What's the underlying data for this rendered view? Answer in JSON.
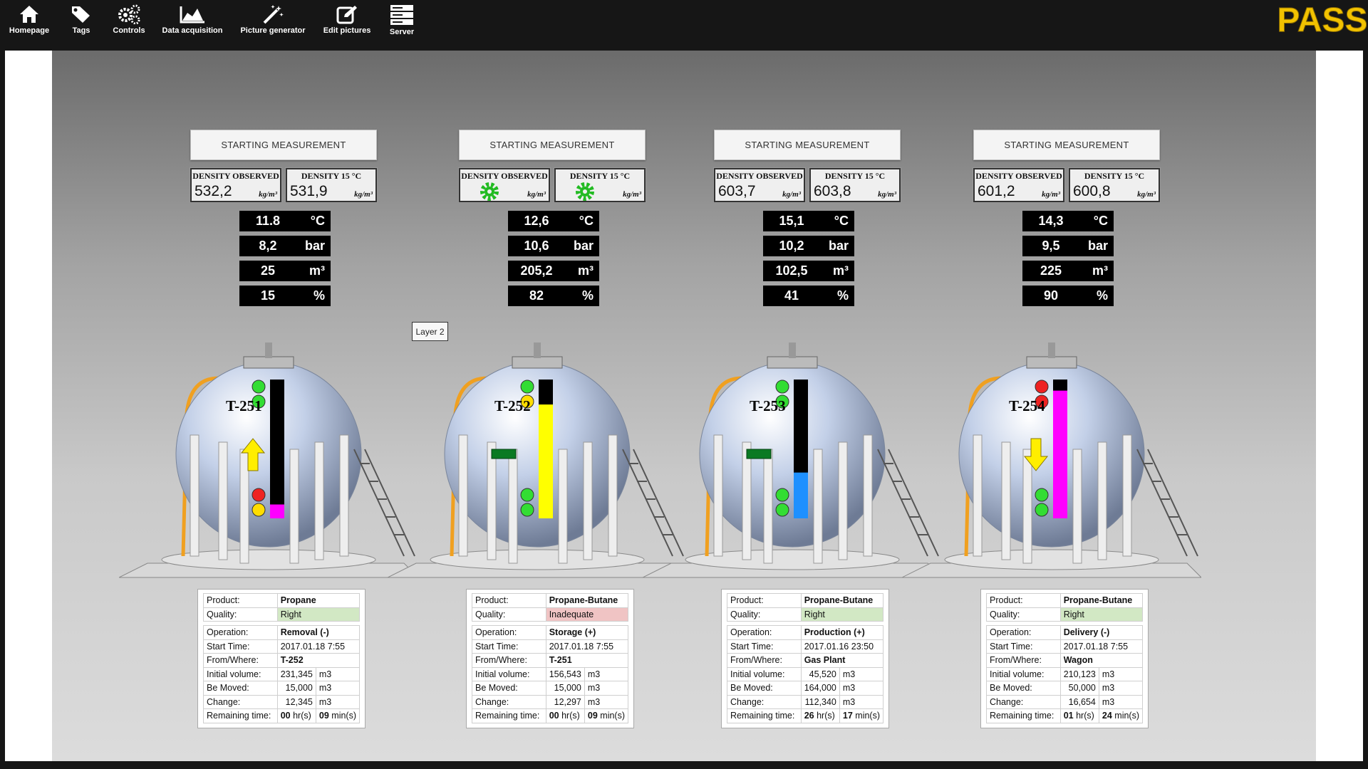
{
  "nav": {
    "items": [
      {
        "label": "Homepage",
        "icon": "home-icon"
      },
      {
        "label": "Tags",
        "icon": "tags-icon"
      },
      {
        "label": "Controls",
        "icon": "gears-icon"
      },
      {
        "label": "Data acquisition",
        "icon": "area-chart-icon"
      },
      {
        "label": "Picture generator",
        "icon": "magic-wand-icon"
      },
      {
        "label": "Edit pictures",
        "icon": "edit-icon"
      },
      {
        "label": "Server",
        "icon": "server-icon"
      }
    ],
    "logo_text": "PASS"
  },
  "layer_label": "Layer 2",
  "tanks": [
    {
      "name": "T-251",
      "start_label": "STARTING MEASUREMENT",
      "density_observed_label": "DENSITY OBSERVED",
      "density_observed": "532,2",
      "density_15_label": "DENSITY 15 °C",
      "density_15": "531,9",
      "density_unit": "kg/m³",
      "temperature": "11.8",
      "temperature_unit": "°C",
      "pressure": "8,2",
      "pressure_unit": "bar",
      "volume": "25",
      "volume_unit": "m³",
      "level_percent": "15",
      "level_unit": "%",
      "level_fraction": 0.1,
      "level_color": "#ff00ff",
      "indicator": "arrow-up",
      "info": {
        "product_label": "Product:",
        "product": "Propane",
        "quality_label": "Quality:",
        "quality": "Right",
        "quality_status": "good",
        "operation_label": "Operation:",
        "operation": "Removal (-)",
        "start_time_label": "Start Time:",
        "start_time": "2017.01.18 7:55",
        "from_where_label": "From/Where:",
        "from_where": "T-252",
        "initial_volume_label": "Initial volume:",
        "initial_volume": "231,345",
        "be_moved_label": "Be Moved:",
        "be_moved": "15,000",
        "change_label": "Change:",
        "change": "12,345",
        "volume_unit": "m3",
        "remaining_label": "Remaining time:",
        "remaining_hours": "00",
        "hours_unit": "hr(s)",
        "remaining_minutes": "09",
        "minutes_unit": "min(s)"
      }
    },
    {
      "name": "T-252",
      "start_label": "STARTING MEASUREMENT",
      "density_observed_label": "DENSITY OBSERVED",
      "density_observed": "",
      "density_15_label": "DENSITY 15 °C",
      "density_15": "",
      "density_unit": "kg/m³",
      "temperature": "12,6",
      "temperature_unit": "°C",
      "pressure": "10,6",
      "pressure_unit": "bar",
      "volume": "205,2",
      "volume_unit": "m³",
      "level_percent": "82",
      "level_unit": "%",
      "level_fraction": 0.82,
      "level_color": "#ffff00",
      "indicator": "bar",
      "info": {
        "product_label": "Product:",
        "product": "Propane-Butane",
        "quality_label": "Quality:",
        "quality": "Inadequate",
        "quality_status": "bad",
        "operation_label": "Operation:",
        "operation": "Storage (+)",
        "start_time_label": "Start Time:",
        "start_time": "2017.01.18 7:55",
        "from_where_label": "From/Where:",
        "from_where": "T-251",
        "initial_volume_label": "Initial volume:",
        "initial_volume": "156,543",
        "be_moved_label": "Be Moved:",
        "be_moved": "15,000",
        "change_label": "Change:",
        "change": "12,297",
        "volume_unit": "m3",
        "remaining_label": "Remaining time:",
        "remaining_hours": "00",
        "hours_unit": "hr(s)",
        "remaining_minutes": "09",
        "minutes_unit": "min(s)"
      }
    },
    {
      "name": "T-253",
      "start_label": "STARTING MEASUREMENT",
      "density_observed_label": "DENSITY OBSERVED",
      "density_observed": "603,7",
      "density_15_label": "DENSITY 15 °C",
      "density_15": "603,8",
      "density_unit": "kg/m³",
      "temperature": "15,1",
      "temperature_unit": "°C",
      "pressure": "10,2",
      "pressure_unit": "bar",
      "volume": "102,5",
      "volume_unit": "m³",
      "level_percent": "41",
      "level_unit": "%",
      "level_fraction": 0.33,
      "level_color": "#1e90ff",
      "indicator": "bar",
      "info": {
        "product_label": "Product:",
        "product": "Propane-Butane",
        "quality_label": "Quality:",
        "quality": "Right",
        "quality_status": "good",
        "operation_label": "Operation:",
        "operation": "Production (+)",
        "start_time_label": "Start Time:",
        "start_time": "2017.01.16 23:50",
        "from_where_label": "From/Where:",
        "from_where": "Gas Plant",
        "initial_volume_label": "Initial volume:",
        "initial_volume": "45,520",
        "be_moved_label": "Be Moved:",
        "be_moved": "164,000",
        "change_label": "Change:",
        "change": "112,340",
        "volume_unit": "m3",
        "remaining_label": "Remaining time:",
        "remaining_hours": "26",
        "hours_unit": "hr(s)",
        "remaining_minutes": "17",
        "minutes_unit": "min(s)"
      }
    },
    {
      "name": "T-254",
      "start_label": "STARTING MEASUREMENT",
      "density_observed_label": "DENSITY OBSERVED",
      "density_observed": "601,2",
      "density_15_label": "DENSITY 15 °C",
      "density_15": "600,8",
      "density_unit": "kg/m³",
      "temperature": "14,3",
      "temperature_unit": "°C",
      "pressure": "9,5",
      "pressure_unit": "bar",
      "volume": "225",
      "volume_unit": "m³",
      "level_percent": "90",
      "level_unit": "%",
      "level_fraction": 0.92,
      "level_color": "#ff00ff",
      "indicator": "arrow-down",
      "info": {
        "product_label": "Product:",
        "product": "Propane-Butane",
        "quality_label": "Quality:",
        "quality": "Right",
        "quality_status": "good",
        "operation_label": "Operation:",
        "operation": "Delivery (-)",
        "start_time_label": "Start Time:",
        "start_time": "2017.01.18 7:55",
        "from_where_label": "From/Where:",
        "from_where": "Wagon",
        "initial_volume_label": "Initial volume:",
        "initial_volume": "210,123",
        "be_moved_label": "Be Moved:",
        "be_moved": "50,000",
        "change_label": "Change:",
        "change": "16,654",
        "volume_unit": "m3",
        "remaining_label": "Remaining time:",
        "remaining_hours": "01",
        "hours_unit": "hr(s)",
        "remaining_minutes": "24",
        "minutes_unit": "min(s)"
      }
    }
  ]
}
